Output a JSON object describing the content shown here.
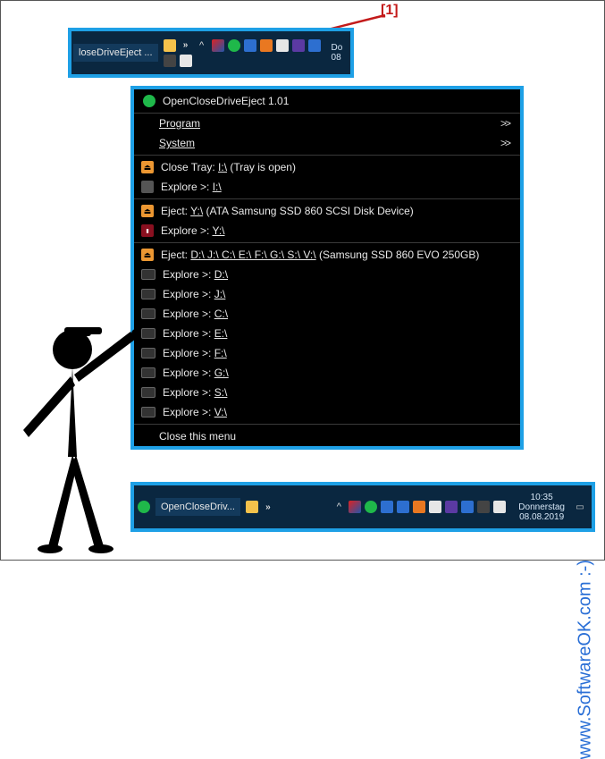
{
  "annotation": {
    "label": "[1]"
  },
  "taskbar_top": {
    "task_label": "loseDriveEject ...",
    "clock": "Do\n08"
  },
  "menu": {
    "title": "OpenCloseDriveEject 1.01",
    "program": "Program",
    "system": "System",
    "arrow": ">>",
    "close_tray_prefix": "Close Tray: ",
    "close_tray_drive": "I:\\",
    "close_tray_suffix": " (Tray is open)",
    "explore_prefix": "Explore >: ",
    "explore_i": "I:\\",
    "eject_y_prefix": "Eject: ",
    "eject_y_drive": "Y:\\",
    "eject_y_suffix": "  (ATA Samsung SSD 860 SCSI Disk Device)",
    "explore_y": "Y:\\",
    "eject_multi_prefix": "Eject: ",
    "eject_multi_drives": "D:\\ J:\\ C:\\ E:\\ F:\\ G:\\ S:\\ V:\\",
    "eject_multi_suffix": "  (Samsung SSD 860 EVO 250GB)",
    "explore_d": "D:\\",
    "explore_j": "J:\\",
    "explore_c": "C:\\",
    "explore_e": "E:\\",
    "explore_f": "F:\\",
    "explore_g": "G:\\",
    "explore_s": "S:\\",
    "explore_v": "V:\\",
    "close_menu": "Close this menu"
  },
  "taskbar_bottom": {
    "task_label": "OpenCloseDriv...",
    "time": "10:35",
    "day": "Donnerstag",
    "date": "08.08.2019"
  },
  "watermark": "www.SoftwareOK.com :-)"
}
